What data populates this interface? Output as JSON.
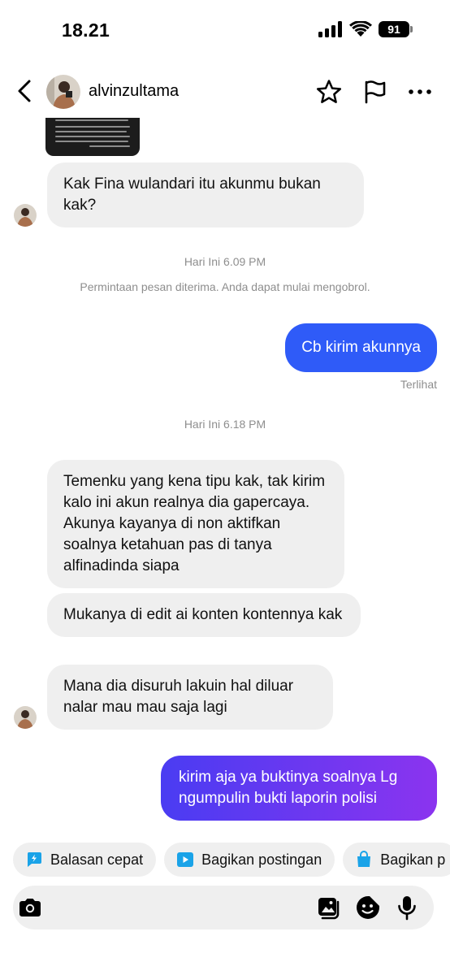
{
  "status_bar": {
    "time": "18.21",
    "battery": "91"
  },
  "header": {
    "username": "alvinzultama"
  },
  "messages": {
    "m1": "Kak Fina wulandari itu akunmu bukan kak?",
    "ts1": "Hari Ini 6.09 PM",
    "system": "Permintaan pesan diterima. Anda dapat mulai mengobrol.",
    "m2": "Cb kirim akunnya",
    "seen": "Terlihat",
    "ts2": "Hari Ini 6.18 PM",
    "m3": "Temenku yang kena tipu kak, tak kirim kalo ini akun realnya dia gapercaya. Akunya kayanya di non aktifkan soalnya ketahuan pas di tanya alfinadinda siapa",
    "m4": "Mukanya di edit ai konten kontennya kak",
    "m5": "Mana dia disuruh lakuin hal diluar nalar mau mau saja lagi",
    "m6": "kirim aja ya buktinya soalnya Lg ngumpulin bukti laporin polisi"
  },
  "quick_replies": [
    {
      "label": "Balasan cepat",
      "icon": "lightning-icon"
    },
    {
      "label": "Bagikan postingan",
      "icon": "play-icon"
    },
    {
      "label": "Bagikan p",
      "icon": "shopping-bag-icon"
    }
  ],
  "colors": {
    "bubble_in": "#efefef",
    "bubble_out": "#2f5bf8",
    "bubble_out_gradient_start": "#4a3cf2",
    "bubble_out_gradient_end": "#8b34ef",
    "chip_icon": "#1aa3e8"
  },
  "composer": {
    "icons": [
      "camera-icon",
      "gallery-icon",
      "sticker-icon",
      "microphone-icon"
    ]
  }
}
